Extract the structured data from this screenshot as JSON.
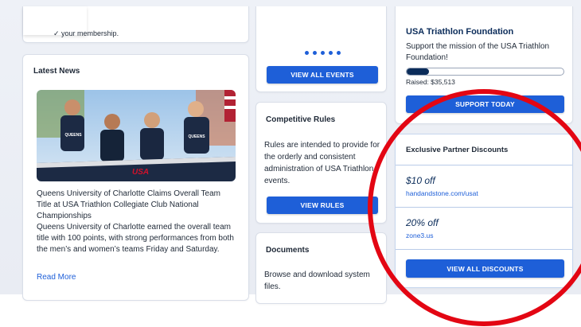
{
  "membership_card": {
    "text": "✓ your membership."
  },
  "latest_news": {
    "title": "Latest News",
    "headline": "Queens University of Charlotte Claims Overall Team Title at USA Triathlon Collegiate Club National Championships",
    "body": "Queens University of Charlotte earned the overall team title with 100 points, with strong performances from both the men’s and women’s teams Friday and Saturday.",
    "read_more": "Read More",
    "photo_jersey_text": "QUEENS",
    "photo_banner_text": "USA"
  },
  "events_card": {
    "button_label": "VIEW ALL EVENTS"
  },
  "rules_card": {
    "title": "Competitive Rules",
    "body": "Rules are intended to provide for the orderly and consistent administration of USA Triathlon events.",
    "button_label": "VIEW RULES"
  },
  "documents_card": {
    "title": "Documents",
    "body": "Browse and download system files."
  },
  "foundation_card": {
    "title": "USA Triathlon Foundation",
    "body": "Support the mission of the USA Triathlon Foundation!",
    "raised_label": "Raised: $35,513",
    "progress": 0.14,
    "button_label": "SUPPORT TODAY"
  },
  "discounts_card": {
    "title": "Exclusive Partner Discounts",
    "offers": [
      {
        "amount": "$10 off",
        "site": "handandstone.com/usat"
      },
      {
        "amount": "20% off",
        "site": "zone3.us"
      }
    ],
    "button_label": "VIEW ALL DISCOUNTS"
  },
  "colors": {
    "accent": "#1e5fd8",
    "navy": "#0b2c5a",
    "annotation_red": "#e30613"
  }
}
